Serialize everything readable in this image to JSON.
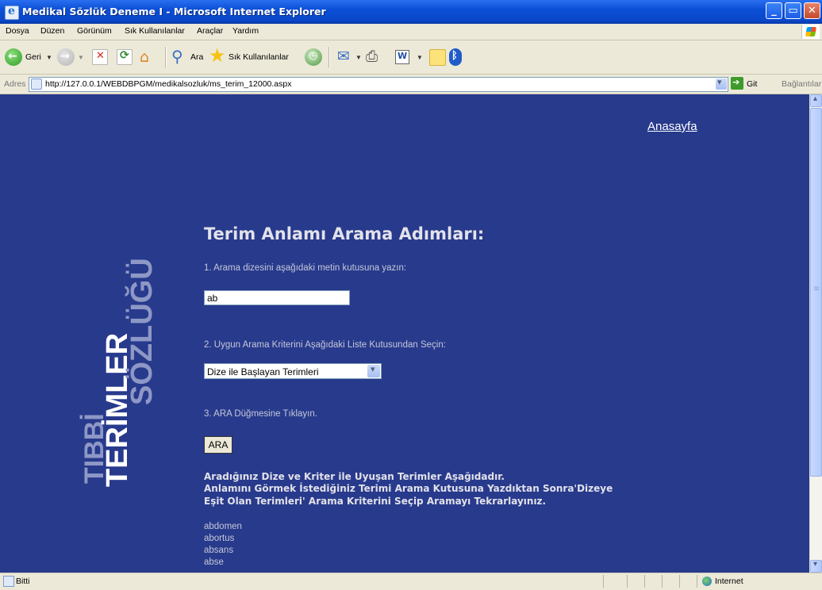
{
  "window": {
    "title": "Medikal Sözlük Deneme I - Microsoft Internet Explorer"
  },
  "menu": [
    "Dosya",
    "Düzen",
    "Görünüm",
    "Sık Kullanılanlar",
    "Araçlar",
    "Yardım"
  ],
  "toolbar": {
    "back": "Geri",
    "search": "Ara",
    "favorites": "Sık Kullanılanlar"
  },
  "address": {
    "label": "Adres",
    "url": "http://127.0.0.1/WEBDBPGM/medikalsozluk/ms_terim_12000.aspx",
    "go": "Git",
    "links": "Bağlantılar"
  },
  "page": {
    "home_link": "Anasayfa",
    "vertical_title": {
      "line1": "TIBBİ",
      "line2": "TERİMLER",
      "line3": "SÖZLÜĞÜ"
    },
    "heading": "Terim Anlamı Arama Adımları:",
    "step1": "1. Arama dizesini aşağıdaki metin kutusuna yazın:",
    "search_value": "ab",
    "step2": "2. Uygun Arama Kriterini Aşağıdaki Liste Kutusundan Seçin:",
    "criteria_selected": "Dize ile Başlayan Terimleri",
    "step3": "3. ARA Düğmesine Tıklayın.",
    "search_button": "ARA",
    "result_msg1": "Aradığınız Dize ve Kriter ile Uyuşan Terimler Aşağıdadır.",
    "result_msg2": "Anlamını Görmek İstediğiniz Terimi Arama Kutusuna Yazdıktan Sonra'Dizeye",
    "result_msg3": "Eşit Olan Terimleri' Arama Kriterini Seçip Aramayı Tekrarlayınız.",
    "terms": [
      "abdomen",
      "abortus",
      "absans",
      "abse"
    ]
  },
  "status": {
    "text": "Bitti",
    "zone": "Internet"
  },
  "colors": {
    "page_bg": "#283a8c",
    "titlebar": "#0b4fd6"
  }
}
